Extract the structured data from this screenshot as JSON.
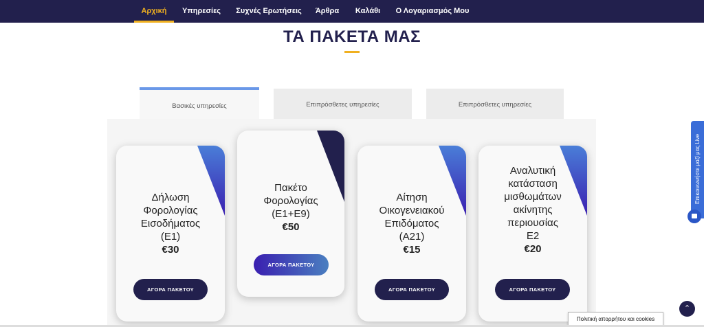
{
  "nav": {
    "items": [
      {
        "label": "Αρχική",
        "active": true
      },
      {
        "label": "Υπηρεσίες"
      },
      {
        "label": "Συχνές Ερωτήσεις"
      },
      {
        "label": "Άρθρα"
      },
      {
        "label": "Καλάθι"
      },
      {
        "label": "Ο Λογαριασμός Μου"
      }
    ]
  },
  "page": {
    "title": "ΤΑ ΠΑΚΕΤΑ ΜΑΣ"
  },
  "tabs": [
    {
      "label": "Βασικές υπηρεσίες",
      "active": true
    },
    {
      "label": "Επιπρόσθετες υπηρεσίες"
    },
    {
      "label": "Επιπρόσθετες υπηρεσίες"
    }
  ],
  "cards": [
    {
      "lines": [
        "Δήλωση",
        "Φορολογίας",
        "Εισοδήματος",
        "(Ε1)"
      ],
      "price": "€30",
      "button": "ΑΓΟΡΑ ΠΑΚΕΤΟΥ"
    },
    {
      "lines": [
        "Πακέτο",
        "Φορολογίας",
        "(Ε1+Ε9)"
      ],
      "price": "€50",
      "button": "ΑΓΟΡΑ ΠΑΚΕΤΟΥ"
    },
    {
      "lines": [
        "Αίτηση",
        "Οικογενειακού",
        "Επιδόματος",
        "(Α21)"
      ],
      "price": "€15",
      "button": "ΑΓΟΡΑ ΠΑΚΕΤΟΥ"
    },
    {
      "lines": [
        "Αναλυτική",
        "κατάσταση",
        "μισθωμάτων",
        "ακίνητης",
        "περιουσίας",
        "Ε2"
      ],
      "price": "€20",
      "button": "ΑΓΟΡΑ ΠΑΚΕΤΟΥ"
    }
  ],
  "live_chat": {
    "label": "Επικοινωνήστε μαζί μας Live"
  },
  "cookie": {
    "label": "Πολιτική απορρήτου και cookies"
  },
  "colors": {
    "nav_bg": "#22204d",
    "accent": "#f0b020",
    "tab_active_border": "#6a98e8",
    "button_dark": "#22204d",
    "live_blue": "#3a6dd8"
  },
  "icons": {
    "scroll_top": "chevron-up-icon",
    "chat": "chat-icon"
  }
}
